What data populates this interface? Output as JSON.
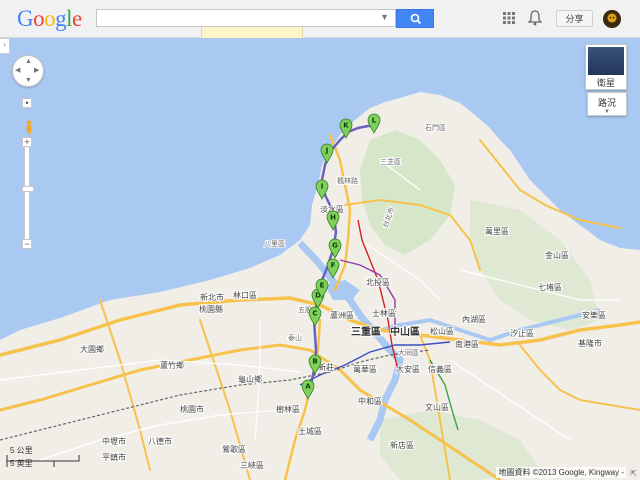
{
  "header": {
    "logo_letters": [
      {
        "ch": "G",
        "color": "#4285f4"
      },
      {
        "ch": "o",
        "color": "#ea4335"
      },
      {
        "ch": "o",
        "color": "#fbbc05"
      },
      {
        "ch": "g",
        "color": "#4285f4"
      },
      {
        "ch": "l",
        "color": "#34a853"
      },
      {
        "ch": "e",
        "color": "#ea4335"
      }
    ],
    "search_value": "",
    "search_icon": "search-icon",
    "apps_icon": "apps-grid-icon",
    "bell_icon": "notifications-bell-icon",
    "share_label": "分享",
    "avatar_icon": "avatar-icon"
  },
  "map_controls": {
    "pan_icon": "pan-control-icon",
    "zoom_in": "+",
    "zoom_out": "−",
    "pegman_icon": "street-view-pegman-icon",
    "satellite_label": "衛星",
    "traffic_label": "路況",
    "side_tab_icon": "›"
  },
  "scale": {
    "top": "5 公里",
    "bottom": "5 英里"
  },
  "copyright": "地圖資料 ©2013 Google, Kingway -",
  "colors": {
    "water": "#a9c9f3",
    "land": "#f1eee8",
    "highway": "#f7c24c",
    "route": "#6b5fc3",
    "marker": "#7ed05b"
  },
  "labels": {
    "shimen": "石門區",
    "sanzhi": "三芝區",
    "tamsui": "淡水區",
    "beitou": "北投區",
    "shilin": "士林區",
    "zhongshan": "中山區",
    "sanchong": "三重區",
    "luzhou": "蘆洲區",
    "wugu": "五股",
    "taishan": "泰山",
    "xinzhuang": "新莊",
    "linkou": "林口區",
    "taoyuan_county": "桃園縣",
    "newtaipei_county": "新北市",
    "datong": "大同區",
    "daan": "大安區",
    "xinyi": "信義區",
    "songshan": "松山區",
    "neihu": "內湖區",
    "nangang": "南港區",
    "xizhi": "汐止區",
    "keelung": "基隆市",
    "wanhua": "萬華區",
    "zhonghe": "中和區",
    "wenshan": "文山區",
    "xindian": "新店區",
    "tucheng": "土城區",
    "shulin": "樹林區",
    "yingge": "鶯歌區",
    "sanxia": "三峽區",
    "bade": "八德市",
    "taoyuan_city": "桃園市",
    "zhongli": "中壢市",
    "pingzhen": "平鎮市",
    "luzhu": "蘆竹鄉",
    "dayuan": "大園鄉",
    "guishan": "龜山鄉",
    "jinshan": "金山區",
    "wanli": "萬里區",
    "qidu": "七堵區",
    "anle": "安樂區",
    "fengshu": "楓林路",
    "bali": "八里區",
    "taipei_county": "台北市"
  },
  "route_markers": [
    "A",
    "B",
    "C",
    "D",
    "E",
    "F",
    "G",
    "H",
    "I",
    "J",
    "K",
    "L"
  ]
}
